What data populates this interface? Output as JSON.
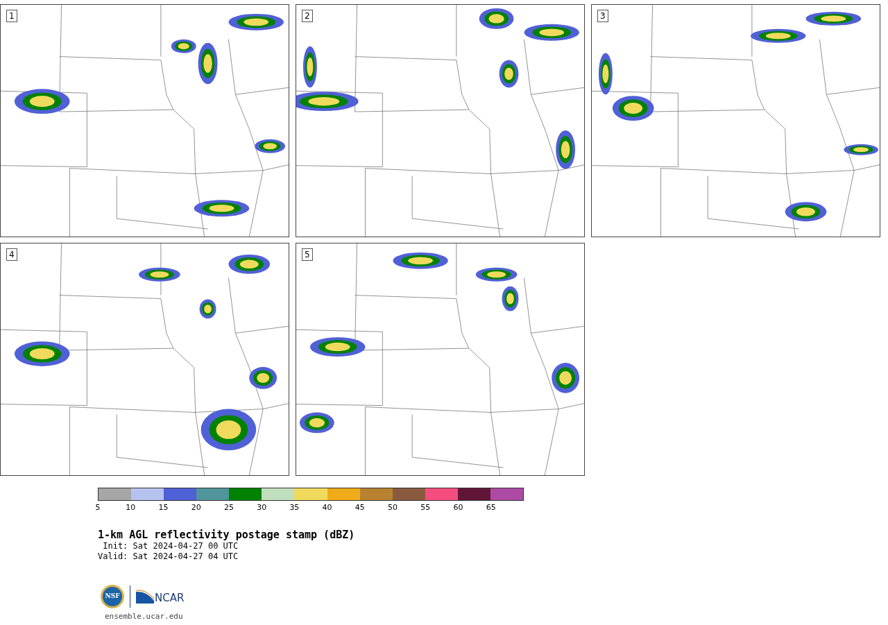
{
  "panels": [
    {
      "number": "1"
    },
    {
      "number": "2"
    },
    {
      "number": "3"
    },
    {
      "number": "4"
    },
    {
      "number": "5"
    }
  ],
  "legend": {
    "bins": [
      {
        "color": "#a6a6a6",
        "tick": "5"
      },
      {
        "color": "#b7c3ef",
        "tick": "10"
      },
      {
        "color": "#5060d6",
        "tick": "15"
      },
      {
        "color": "#50959b",
        "tick": "20"
      },
      {
        "color": "#008200",
        "tick": "25"
      },
      {
        "color": "#c0dfbf",
        "tick": "30"
      },
      {
        "color": "#f0da5d",
        "tick": "35"
      },
      {
        "color": "#f0ab18",
        "tick": "40"
      },
      {
        "color": "#b88231",
        "tick": "45"
      },
      {
        "color": "#8a5a3f",
        "tick": "50"
      },
      {
        "color": "#f44e7f",
        "tick": "55"
      },
      {
        "color": "#611638",
        "tick": "60"
      },
      {
        "color": "#ad4ba4",
        "tick": "65"
      }
    ]
  },
  "title": "1-km AGL reflectivity postage stamp (dBZ)",
  "init": " Init: Sat 2024-04-27 00 UTC",
  "valid": "Valid: Sat 2024-04-27 04 UTC",
  "logos": {
    "nsf": "NSF",
    "ncar": "NCAR"
  },
  "footer": "ensemble.ucar.edu"
}
